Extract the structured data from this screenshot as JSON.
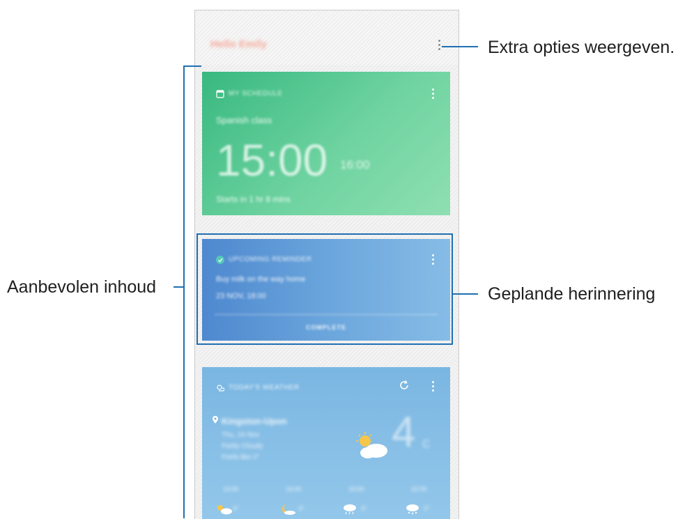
{
  "header": {
    "greeting": "Hello Emily",
    "more_options_icon": "more-vert-icon"
  },
  "cards": {
    "schedule": {
      "category": "MY SCHEDULE",
      "event": "Spanish class",
      "start": "15:00",
      "end": "16:00",
      "note": "Starts in 1 hr 8 mins"
    },
    "reminder": {
      "category": "UPCOMING REMINDER",
      "text": "Buy milk on the way home",
      "when": "23 NOV, 18:00",
      "action": "COMPLETE"
    },
    "weather": {
      "category": "TODAY'S WEATHER",
      "location": "Kingston-Upon",
      "line1": "Thu, 24 Nov",
      "line2": "Partly Cloudy",
      "line3": "Feels like 2°",
      "temp": "4",
      "unit": "c",
      "forecast": [
        {
          "time": "13:00",
          "icon": "partly-sunny-icon",
          "temp": "4°"
        },
        {
          "time": "16:00",
          "icon": "moon-icon",
          "temp": "3°"
        },
        {
          "time": "19:00",
          "icon": "rain-cloud-icon",
          "temp": "3°"
        },
        {
          "time": "22:00",
          "icon": "snow-cloud-icon",
          "temp": "2°"
        }
      ]
    }
  },
  "callouts": {
    "more_options": "Extra opties weergeven.",
    "recommended": "Aanbevolen inhoud",
    "scheduled_reminder": "Geplande herinnering"
  }
}
